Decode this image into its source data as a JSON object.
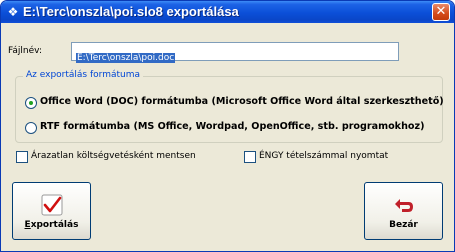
{
  "window": {
    "title": "E:\\Terc\\onszla\\poi.slo8 exportálása",
    "app_icon": "app-icon",
    "close_glyph": "✕"
  },
  "filename": {
    "label": "Fájlnév:",
    "value": "E:\\Terc\\onszla\\poi.doc"
  },
  "format_group": {
    "legend": "Az exportálás formátuma",
    "options": [
      {
        "label": "Office Word (DOC) formátumba (Microsoft Office Word által szerkeszthető)",
        "checked": true
      },
      {
        "label": "RTF  formátumba  (MS Office, Wordpad, OpenOffice, stb. programokhoz)",
        "checked": false
      }
    ]
  },
  "options": {
    "unpriced_as_cost": "Árazatlan költségvetésként mentsen",
    "engy_print": "ÉNGY tételszámmal nyomtat"
  },
  "buttons": {
    "export": "Exportálás",
    "close": "Bezár"
  },
  "colors": {
    "title_bar": "#0a4fd8",
    "window_bg": "#ece9d8",
    "legend_text": "#0046d5",
    "selection": "#316ac5",
    "checkmark": "#d01010",
    "close_arrow": "#c0202a"
  }
}
